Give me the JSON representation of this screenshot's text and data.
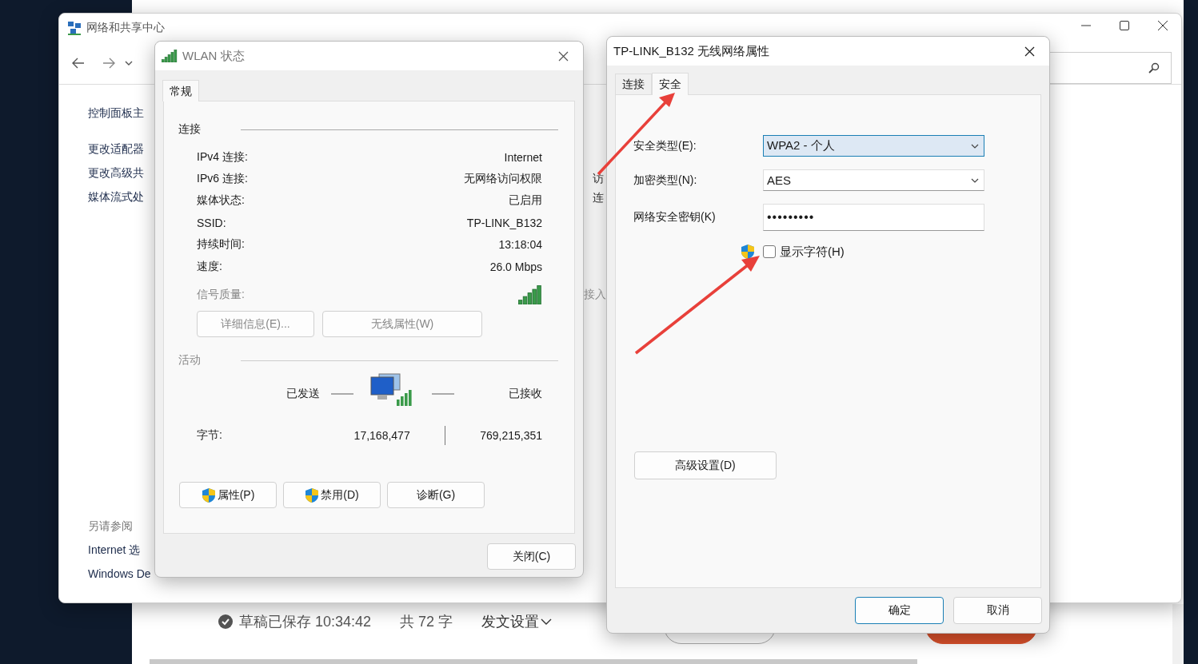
{
  "network_center": {
    "title": "网络和共享中心",
    "left_links": [
      "控制面板主",
      "更改适配器",
      "更改高级共",
      "媒体流式处"
    ],
    "see_also_heading": "另请参阅",
    "see_also_links": [
      "Internet 选",
      "Windows De"
    ],
    "partial_texts": [
      "访",
      "连",
      "接入"
    ]
  },
  "wlan_status": {
    "title": "WLAN 状态",
    "tabs": [
      {
        "label": "常规",
        "selected": true
      }
    ],
    "connection_heading": "连接",
    "rows": [
      {
        "label": "IPv4 连接:",
        "value": "Internet"
      },
      {
        "label": "IPv6 连接:",
        "value": "无网络访问权限"
      },
      {
        "label": "媒体状态:",
        "value": "已启用"
      },
      {
        "label": "SSID:",
        "value": "TP-LINK_B132"
      },
      {
        "label": "持续时间:",
        "value": "13:18:04"
      },
      {
        "label": "速度:",
        "value": "26.0 Mbps"
      }
    ],
    "signal_label": "信号质量:",
    "detail_buttons": [
      "详细信息(E)...",
      "无线属性(W)"
    ],
    "activity_heading": "活动",
    "sent_label": "已发送",
    "received_label": "已接收",
    "bytes_label": "字节:",
    "bytes_sent": "17,168,477",
    "bytes_received": "769,215,351",
    "action_buttons": [
      {
        "label": "属性(P)",
        "shield": true
      },
      {
        "label": "禁用(D)",
        "shield": true
      },
      {
        "label": "诊断(G)",
        "shield": false
      }
    ],
    "close_button": "关闭(C)"
  },
  "properties": {
    "title": "TP-LINK_B132 无线网络属性",
    "tabs": [
      {
        "label": "连接",
        "selected": false
      },
      {
        "label": "安全",
        "selected": true
      }
    ],
    "fields": [
      {
        "kind": "dropdown",
        "label": "安全类型(E):",
        "value": "WPA2 - 个人",
        "focused": true
      },
      {
        "kind": "dropdown",
        "label": "加密类型(N):",
        "value": "AES",
        "focused": false
      },
      {
        "kind": "password",
        "label": "网络安全密钥(K)",
        "value": "•••••••••",
        "focused": false
      }
    ],
    "show_chars": {
      "label": "显示字符(H)",
      "checked": false
    },
    "advanced_button": "高级设置(D)",
    "ok_button": "确定",
    "cancel_button": "取消"
  },
  "editor_bar": {
    "saved_status": "草稿已保存 10:34:42",
    "word_count": "共 72 字",
    "publish_settings": "发文设置"
  }
}
